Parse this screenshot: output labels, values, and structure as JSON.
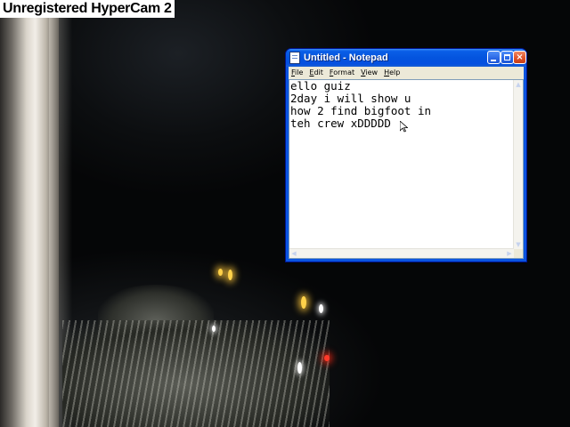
{
  "watermark": {
    "text": "Unregistered HyperCam 2"
  },
  "notepad": {
    "title": "Untitled - Notepad",
    "icon": "notepad-icon",
    "controls": {
      "minimize": "minimize-icon",
      "maximize": "maximize-icon",
      "close": "×"
    },
    "menu": [
      {
        "label": "File"
      },
      {
        "label": "Edit"
      },
      {
        "label": "Format"
      },
      {
        "label": "View"
      },
      {
        "label": "Help"
      }
    ],
    "text": "ello guiz\n2day i will show u\nhow 2 find bigfoot in\nteh crew xDDDDD"
  },
  "colors": {
    "titlebar": "#0454de",
    "close_button": "#e2532a",
    "menubar": "#ece9d8",
    "editor_bg": "#ffffff",
    "game_lights_yellow": "#ffd24a",
    "game_lights_red": "#ff3a2a"
  }
}
